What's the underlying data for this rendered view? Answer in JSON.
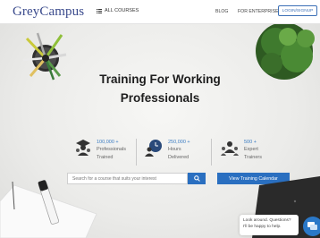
{
  "navbar": {
    "logo": "GreyCampus",
    "all_courses": "ALL COURSES",
    "blog": "BLOG",
    "for_enterprise": "FOR ENTERPRISE",
    "login_signup": "LOGIN/SIGNUP"
  },
  "hero": {
    "title_line1": "Training For Working",
    "title_line2": "Professionals"
  },
  "stats": [
    {
      "number": "100,000 +",
      "line1": "Professionals",
      "line2": "Trained",
      "icon": "graduate-icon"
    },
    {
      "number": "250,000 +",
      "line1": "Hours",
      "line2": "Delivered",
      "icon": "clock-person-icon"
    },
    {
      "number": "500 +",
      "line1": "Expert",
      "line2": "Trainers",
      "icon": "trainer-icon"
    }
  ],
  "search": {
    "placeholder": "Search for a course that suits your interest"
  },
  "calendar_button": "View Training Calendar",
  "chat": {
    "line1": "Look around. Questions?",
    "line2": "I'll be happy to help."
  },
  "colors": {
    "brand_blue": "#2a6fc0",
    "logo_blue": "#3a4a8c",
    "stat_blue": "#3b7cc2"
  }
}
